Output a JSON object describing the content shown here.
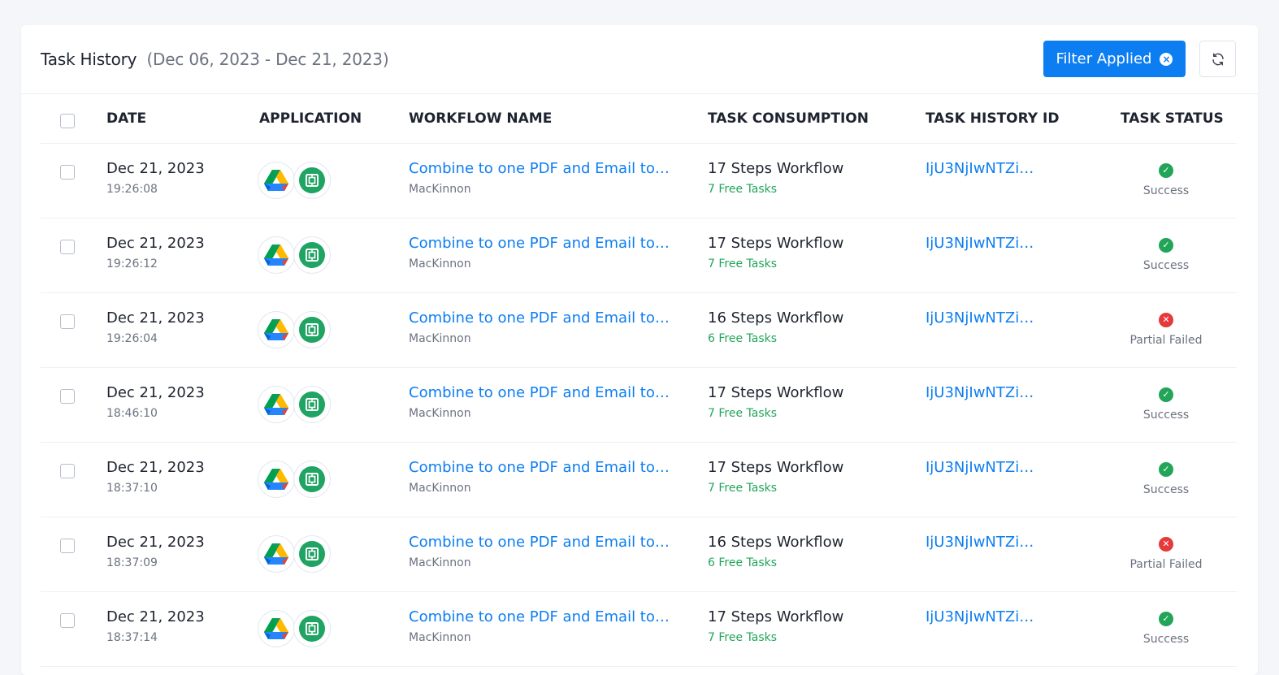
{
  "header": {
    "title": "Task History",
    "date_range": "(Dec 06, 2023 - Dec 21, 2023)",
    "filter_label": "Filter Applied",
    "filter_clear_icon": "close-circle-icon",
    "refresh_icon": "refresh-icon"
  },
  "columns": [
    "DATE",
    "APPLICATION",
    "WORKFLOW NAME",
    "TASK CONSUMPTION",
    "TASK HISTORY ID",
    "TASK STATUS"
  ],
  "apps": [
    "google-drive-icon",
    "green-app-icon"
  ],
  "rows": [
    {
      "date": "Dec 21, 2023",
      "time": "19:26:08",
      "workflow": "Combine to one PDF and Email to…",
      "owner": "MacKinnon",
      "steps": "17 Steps Workflow",
      "free": "7 Free Tasks",
      "history_id": "IjU3NjIwNTZi…",
      "status": "Success",
      "status_type": "ok"
    },
    {
      "date": "Dec 21, 2023",
      "time": "19:26:12",
      "workflow": "Combine to one PDF and Email to…",
      "owner": "MacKinnon",
      "steps": "17 Steps Workflow",
      "free": "7 Free Tasks",
      "history_id": "IjU3NjIwNTZi…",
      "status": "Success",
      "status_type": "ok"
    },
    {
      "date": "Dec 21, 2023",
      "time": "19:26:04",
      "workflow": "Combine to one PDF and Email to…",
      "owner": "MacKinnon",
      "steps": "16 Steps Workflow",
      "free": "6 Free Tasks",
      "history_id": "IjU3NjIwNTZi…",
      "status": "Partial Failed",
      "status_type": "bad"
    },
    {
      "date": "Dec 21, 2023",
      "time": "18:46:10",
      "workflow": "Combine to one PDF and Email to…",
      "owner": "MacKinnon",
      "steps": "17 Steps Workflow",
      "free": "7 Free Tasks",
      "history_id": "IjU3NjIwNTZi…",
      "status": "Success",
      "status_type": "ok"
    },
    {
      "date": "Dec 21, 2023",
      "time": "18:37:10",
      "workflow": "Combine to one PDF and Email to…",
      "owner": "MacKinnon",
      "steps": "17 Steps Workflow",
      "free": "7 Free Tasks",
      "history_id": "IjU3NjIwNTZi…",
      "status": "Success",
      "status_type": "ok"
    },
    {
      "date": "Dec 21, 2023",
      "time": "18:37:09",
      "workflow": "Combine to one PDF and Email to…",
      "owner": "MacKinnon",
      "steps": "16 Steps Workflow",
      "free": "6 Free Tasks",
      "history_id": "IjU3NjIwNTZi…",
      "status": "Partial Failed",
      "status_type": "bad"
    },
    {
      "date": "Dec 21, 2023",
      "time": "18:37:14",
      "workflow": "Combine to one PDF and Email to…",
      "owner": "MacKinnon",
      "steps": "17 Steps Workflow",
      "free": "7 Free Tasks",
      "history_id": "IjU3NjIwNTZi…",
      "status": "Success",
      "status_type": "ok"
    }
  ]
}
